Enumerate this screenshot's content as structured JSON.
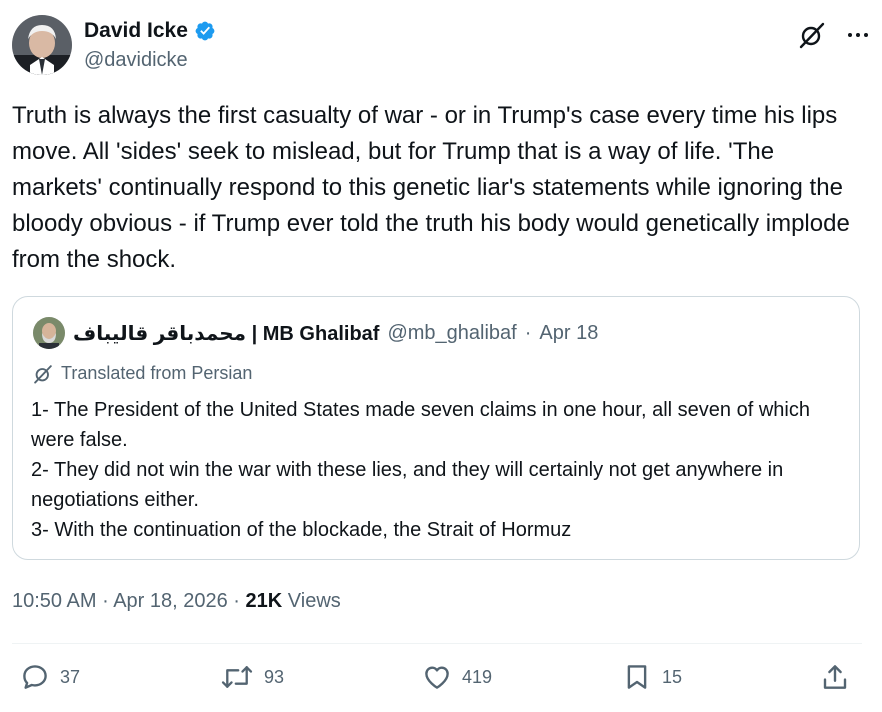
{
  "author": {
    "name": "David Icke",
    "handle": "@davidicke"
  },
  "tweet": {
    "text": "Truth is always the first casualty of war - or in Trump's case every time his lips move. All 'sides' seek to mislead, but for Trump that is a way of life. 'The markets' continually respond to this genetic liar's statements while ignoring the bloody obvious - if Trump ever told the truth his body would genetically implode from the shock."
  },
  "quote": {
    "name": "محمدباقر قالیباف | MB Ghalibaf",
    "handle": "@mb_ghalibaf",
    "separator": "·",
    "date": "Apr 18",
    "translated_label": "Translated from Persian",
    "lines": [
      "1- The President of the United States made seven claims in one hour, all seven of which were false.",
      "2- They did not win the war with these lies, and they will certainly not get anywhere in negotiations either.",
      "3- With the continuation of the blockade, the Strait of Hormuz"
    ]
  },
  "meta": {
    "time": "10:50 AM",
    "date": "Apr 18, 2026",
    "views_count": "21K",
    "views_label": "Views"
  },
  "actions": {
    "replies": "37",
    "reposts": "93",
    "likes": "419",
    "bookmarks": "15"
  },
  "icons": {
    "verified": "verified-badge-icon",
    "grok": "grok-icon",
    "more": "more-icon",
    "reply": "reply-icon",
    "repost": "repost-icon",
    "like": "heart-icon",
    "bookmark": "bookmark-icon",
    "share": "share-icon"
  },
  "colors": {
    "verified": "#1d9bf0",
    "secondary_text": "#536471",
    "primary_text": "#0f1419",
    "border": "#cfd9de"
  }
}
